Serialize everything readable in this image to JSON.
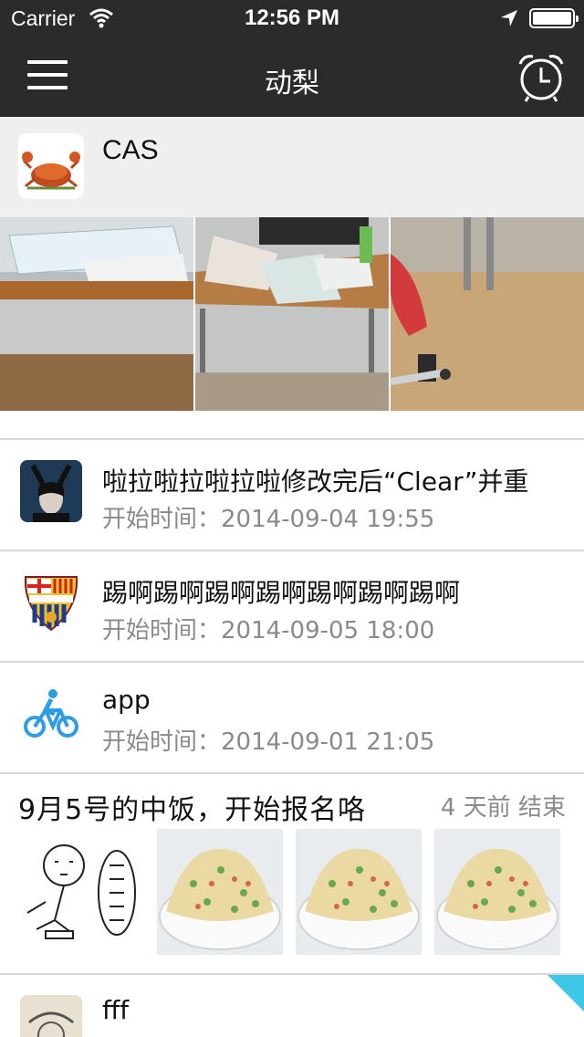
{
  "status_bar": {
    "carrier": "Carrier",
    "time": "12:56 PM"
  },
  "nav": {
    "title": "动梨",
    "left_icon": "menu-icon",
    "right_icon": "alarm-clock-icon"
  },
  "group": {
    "name": "CAS",
    "avatar_icon": "crab-icon"
  },
  "photos": [
    "desk-keyboard-photo",
    "desk-papers-photo",
    "chair-floor-photo"
  ],
  "activities": [
    {
      "icon": "maleficent-avatar",
      "title": "啦拉啦拉啦拉啦修改完后“Clear”并重",
      "start": "开始时间：2014-09-04 19:55"
    },
    {
      "icon": "fcb-crest-icon",
      "title": "踢啊踢啊踢啊踢啊踢啊踢啊踢啊",
      "start": "开始时间：2014-09-05 18:00"
    },
    {
      "icon": "bicycle-icon",
      "title": "app",
      "start": "开始时间：2014-09-01 21:05"
    }
  ],
  "event": {
    "title": "9月5号的中饭，开始报名咯",
    "meta": "4 天前 结束",
    "thumbs": [
      "cartoon-sketch",
      "fried-rice-photo",
      "fried-rice-photo",
      "fried-rice-photo"
    ]
  },
  "partial_item": {
    "title": "fff"
  },
  "colors": {
    "nav_bg": "#2b2b2b",
    "group_bg": "#efefef",
    "muted_text": "#8a8a8a",
    "accent_corner": "#3cc8e6"
  }
}
